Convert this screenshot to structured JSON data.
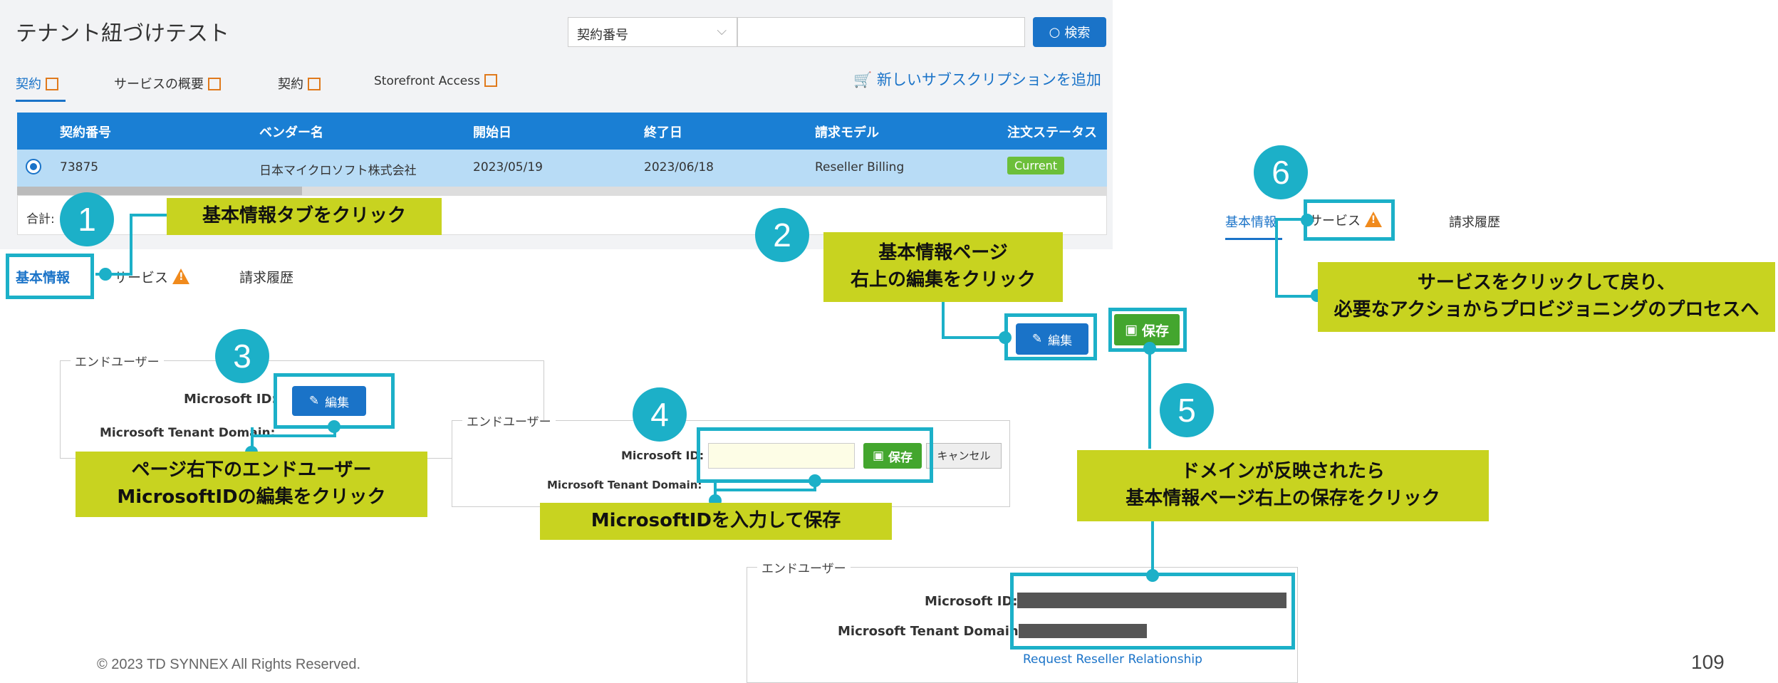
{
  "page": {
    "title": "テナント紐づけテスト",
    "footer": "© 2023 TD SYNNEX All Rights Reserved.",
    "page_number": "109"
  },
  "search": {
    "select_value": "契約番号",
    "button_label": "検索"
  },
  "tabs": [
    "契約",
    "サービスの概要",
    "契約",
    "Storefront Access"
  ],
  "add_subscription": "新しいサブスクリプションを追加",
  "table": {
    "headers": [
      "契約番号",
      "ベンダー名",
      "開始日",
      "終了日",
      "請求モデル",
      "注文ステータス"
    ],
    "row": [
      "73875",
      "日本マイクロソフト株式会社",
      "2023/05/19",
      "2023/06/18",
      "Reseller Billing",
      "Current"
    ],
    "total_label": "合計:"
  },
  "subtabs": {
    "basic": "基本情報",
    "service": "サービス",
    "billing": "請求履歴"
  },
  "buttons": {
    "edit": "編集",
    "save": "保存",
    "cancel": "キャンセル",
    "request": "Request Reseller Relationship"
  },
  "enduser": {
    "legend": "エンドユーザー",
    "ms_id": "Microsoft ID:",
    "tenant_domain": "Microsoft Tenant Domain:"
  },
  "callouts": {
    "c1": "基本情報タブをクリック",
    "c2a": "基本情報ページ",
    "c2b": "右上の編集をクリック",
    "c3a": "ページ右下のエンドユーザー",
    "c3b": "MicrosoftIDの編集をクリック",
    "c4": "MicrosoftIDを入力して保存",
    "c5a": "ドメインが反映されたら",
    "c5b": "基本情報ページ右上の保存をクリック",
    "c6a": "サービスをクリックして戻り、",
    "c6b": "必要なアクショからプロビジョニングのプロセスへ"
  },
  "steps": [
    "1",
    "2",
    "3",
    "4",
    "5",
    "6"
  ]
}
